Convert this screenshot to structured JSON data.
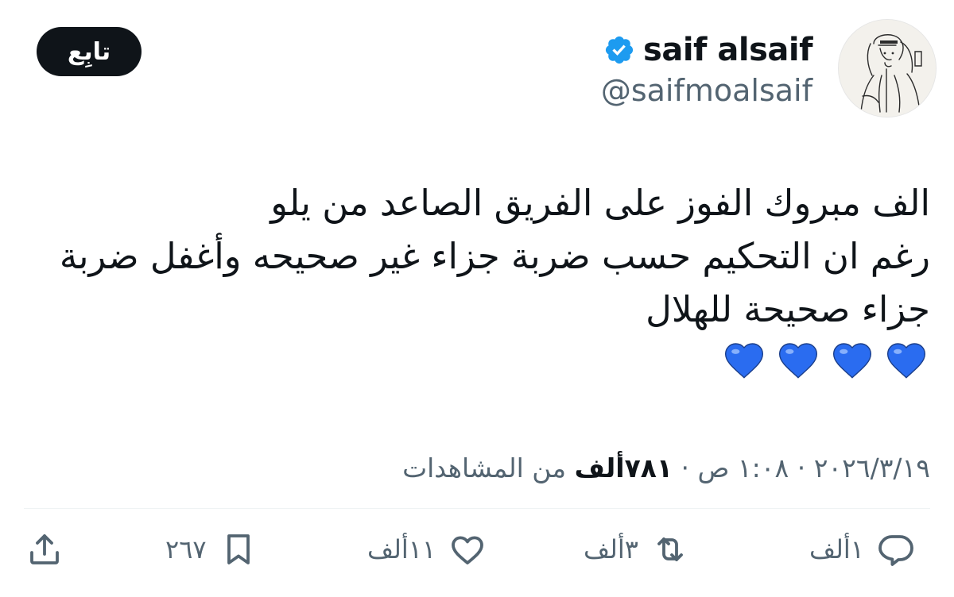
{
  "author": {
    "display_name": "saif alsaif",
    "handle": "@saifmoalsaif",
    "verified_icon": "verified-badge-icon",
    "verified_color": "#1d9bf0"
  },
  "follow_button": {
    "label": "تابِع"
  },
  "tweet": {
    "lines": [
      "الف مبروك الفوز على الفريق الصاعد من يلو",
      "رغم ان التحكيم حسب ضربة جزاء غير صحيحه وأغفل ضربة",
      "جزاء صحيحة للهلال"
    ],
    "emoji": [
      "💙",
      "💙",
      "💙",
      "💙"
    ]
  },
  "meta": {
    "timestamp": "٢٠٢٦/٣/١٩ · ١:٠٨ ص · ",
    "views_count": "٧٨١ألف",
    "views_label": " من المشاهدات"
  },
  "actions": {
    "reply": {
      "icon": "reply-icon",
      "count": "١ألف"
    },
    "retweet": {
      "icon": "retweet-icon",
      "count": "٣ألف"
    },
    "like": {
      "icon": "heart-icon",
      "count": "١١ألف"
    },
    "bookmark": {
      "icon": "bookmark-icon",
      "count": "٢٦٧"
    },
    "share": {
      "icon": "share-icon"
    }
  },
  "colors": {
    "text": "#0f1419",
    "secondary": "#536471",
    "heart_blue": "#2a6cf0",
    "button_bg": "#0f1419"
  }
}
